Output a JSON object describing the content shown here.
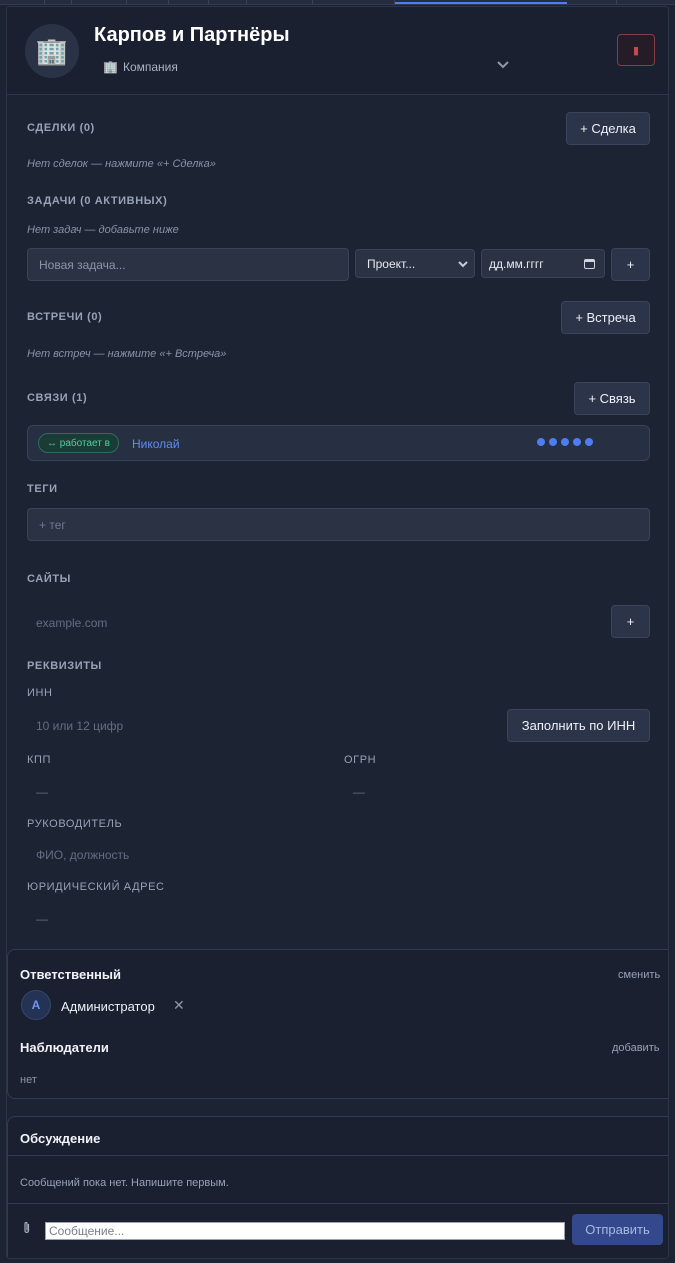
{
  "header": {
    "avatar_icon": "🏢",
    "title": "Карпов и Партнёры",
    "type_icon": "🏢",
    "type_label": "Компания",
    "delete_icon": "▮"
  },
  "deals": {
    "label": "СДЕЛКИ (0)",
    "add_button": "+ Сделка",
    "empty": "Нет сделок — нажмите «+ Сделка»"
  },
  "tasks": {
    "label": "ЗАДАЧИ (0 АКТИВНЫХ)",
    "empty": "Нет задач — добавьте ниже",
    "new_task_placeholder": "Новая задача...",
    "project_select": "Проект...",
    "date_placeholder": "дд.мм.гггг",
    "add_button": "+"
  },
  "meetings": {
    "label": "ВСТРЕЧИ (0)",
    "add_button": "+ Встреча",
    "empty": "Нет встреч — нажмите «+ Встреча»"
  },
  "links": {
    "label": "СВЯЗИ (1)",
    "add_button": "+ Связь",
    "items": [
      {
        "relation": "↔ работает в",
        "name": "Николай",
        "strength": 5
      }
    ]
  },
  "tags": {
    "label": "ТЕГИ",
    "placeholder": "+ тег"
  },
  "sites": {
    "label": "САЙТЫ",
    "placeholder": "example.com",
    "add_button": "+"
  },
  "requisites": {
    "label": "РЕКВИЗИТЫ",
    "inn_label": "ИНН",
    "inn_placeholder": "10 или 12 цифр",
    "fill_button": "Заполнить по ИНН",
    "kpp_label": "КПП",
    "kpp_value": "—",
    "ogrn_label": "ОГРН",
    "ogrn_value": "—",
    "director_label": "РУКОВОДИТЕЛЬ",
    "director_placeholder": "ФИО, должность",
    "address_label": "ЮРИДИЧЕСКИЙ АДРЕС",
    "address_value": "—"
  },
  "responsible": {
    "title": "Ответственный",
    "change_link": "сменить",
    "avatar_letter": "А",
    "user_name": "Администратор",
    "remove_icon": "✕",
    "observers_title": "Наблюдатели",
    "add_link": "добавить",
    "observers_value": "нет"
  },
  "discussion": {
    "title": "Обсуждение",
    "empty": "Сообщений пока нет. Напишите первым.",
    "attach_icon": "📎",
    "message_placeholder": "Сообщение...",
    "send_button": "Отправить"
  },
  "colors": {
    "background": "#1c2333",
    "accent": "#4f7df0",
    "danger": "#c24a55",
    "success": "#4bd29a"
  }
}
